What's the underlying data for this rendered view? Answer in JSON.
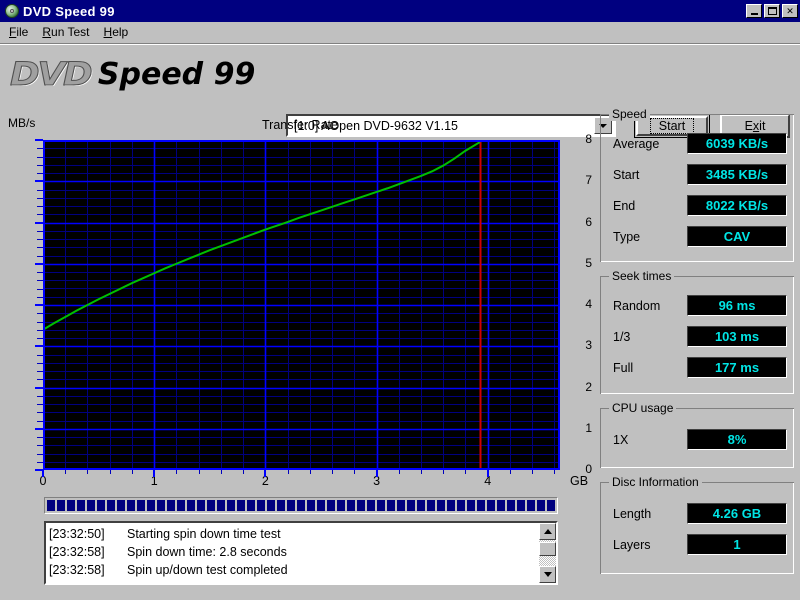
{
  "window": {
    "title": "DVD Speed 99",
    "icon": "disc-icon",
    "buttons": {
      "minimize": "minimize-icon",
      "maximize": "maximize-icon",
      "close": "✕"
    }
  },
  "menu": {
    "items": [
      {
        "label": "File",
        "accel": "F"
      },
      {
        "label": "Run Test",
        "accel": "R"
      },
      {
        "label": "Help",
        "accel": "H"
      }
    ]
  },
  "header": {
    "brand_dvd": "DVD",
    "brand_speed": "Speed 99",
    "drive": {
      "selected": "[1:0]   AOpen DVD-9632 V1.15",
      "options": [
        "[1:0]   AOpen DVD-9632 V1.15"
      ]
    },
    "start_label": "Start",
    "exit_label": "Exit"
  },
  "chart_data": {
    "type": "line",
    "title": "Transfer Rate",
    "xlabel": "GB",
    "ylabel": "MB/s",
    "xlim": [
      0,
      4.65
    ],
    "ylim": [
      0,
      8
    ],
    "grid": true,
    "legend": "none",
    "x_ticks": [
      0,
      1,
      2,
      3,
      4
    ],
    "y_ticks": [
      0,
      1,
      2,
      3,
      4,
      5,
      6,
      7,
      8
    ],
    "series": [
      {
        "name": "Transfer rate",
        "color": "#00c000",
        "x": [
          0.0,
          0.1,
          0.2,
          0.3,
          0.4,
          0.5,
          0.6,
          0.7,
          0.8,
          0.9,
          1.0,
          1.1,
          1.2,
          1.3,
          1.4,
          1.5,
          1.6,
          1.7,
          1.8,
          1.9,
          2.0,
          2.1,
          2.2,
          2.3,
          2.4,
          2.5,
          2.6,
          2.7,
          2.8,
          2.9,
          3.0,
          3.1,
          3.2,
          3.3,
          3.4,
          3.5,
          3.6,
          3.7,
          3.8,
          3.93
        ],
        "y": [
          3.4,
          3.56,
          3.71,
          3.86,
          4.0,
          4.14,
          4.27,
          4.4,
          4.53,
          4.65,
          4.77,
          4.89,
          5.0,
          5.11,
          5.22,
          5.33,
          5.43,
          5.53,
          5.63,
          5.73,
          5.83,
          5.92,
          6.01,
          6.11,
          6.2,
          6.29,
          6.38,
          6.47,
          6.56,
          6.65,
          6.74,
          6.83,
          6.93,
          7.03,
          7.13,
          7.24,
          7.38,
          7.55,
          7.74,
          7.95
        ]
      }
    ],
    "markers": [
      {
        "name": "disc-end-marker",
        "type": "vline",
        "x": 3.93,
        "color": "#d00000"
      }
    ]
  },
  "progress": {
    "name": "test-progress",
    "percent": 100
  },
  "log": {
    "entries": [
      {
        "time": "[23:32:50]",
        "message": "Starting spin down time test"
      },
      {
        "time": "[23:32:58]",
        "message": "Spin down time: 2.8 seconds"
      },
      {
        "time": "[23:32:58]",
        "message": "Spin up/down test completed"
      }
    ]
  },
  "panels": {
    "speed": {
      "title": "Speed",
      "rows": [
        {
          "label": "Average",
          "value": "6039 KB/s"
        },
        {
          "label": "Start",
          "value": "3485 KB/s"
        },
        {
          "label": "End",
          "value": "8022 KB/s"
        },
        {
          "label": "Type",
          "value": "CAV"
        }
      ]
    },
    "seek": {
      "title": "Seek times",
      "rows": [
        {
          "label": "Random",
          "value": "96 ms"
        },
        {
          "label": "1/3",
          "value": "103 ms"
        },
        {
          "label": "Full",
          "value": "177 ms"
        }
      ]
    },
    "cpu": {
      "title": "CPU usage",
      "rows": [
        {
          "label": "1X",
          "value": "8%"
        }
      ]
    },
    "disc": {
      "title": "Disc Information",
      "rows": [
        {
          "label": "Length",
          "value": "4.26 GB"
        },
        {
          "label": "Layers",
          "value": "1"
        }
      ]
    }
  },
  "colors": {
    "lcd_text": "#00e5e5",
    "lcd_bg": "#000000",
    "plot_bg": "#000000",
    "grid_major": "#0000ff",
    "grid_minor": "#000080",
    "curve": "#00c000",
    "marker": "#d00000",
    "titlebar": "#000080",
    "face": "#c0c0c0"
  }
}
